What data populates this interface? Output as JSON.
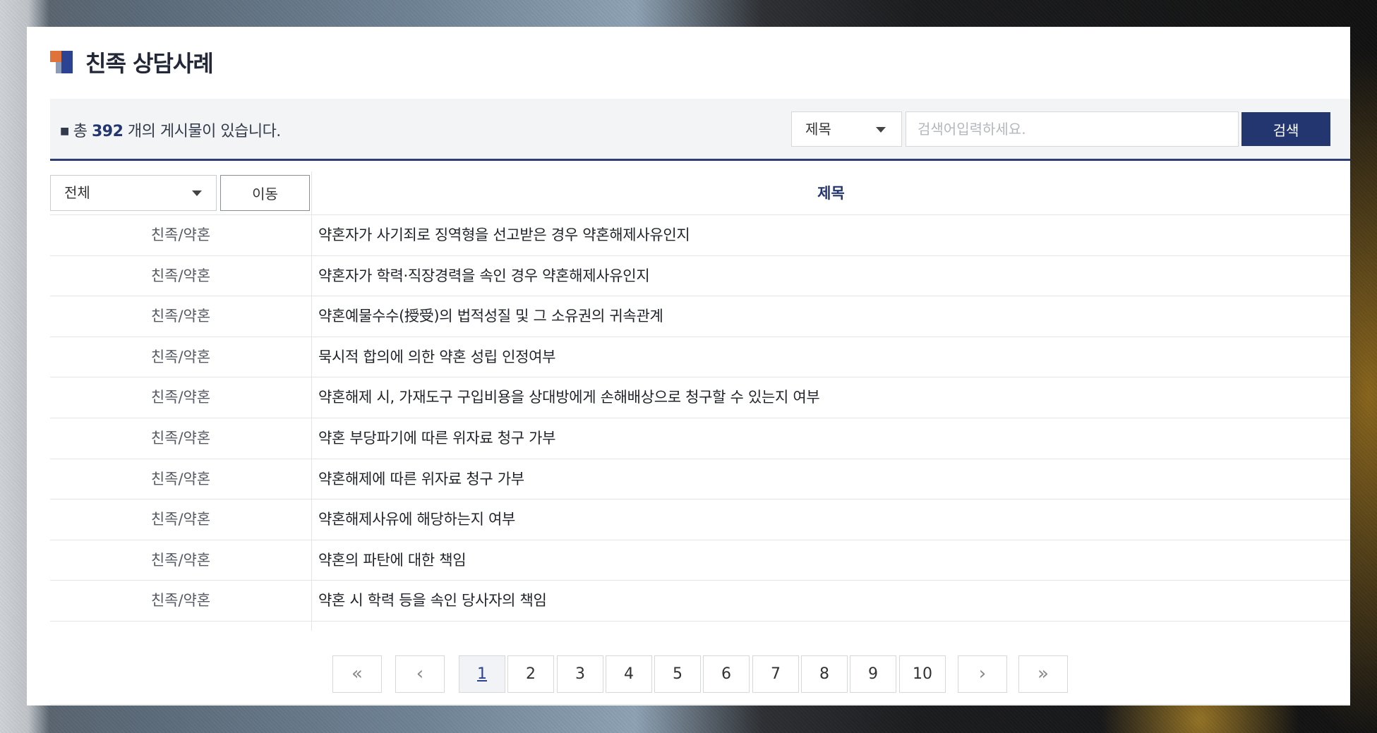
{
  "page": {
    "title": "친족 상담사례"
  },
  "info": {
    "count_prefix": "총",
    "count": "392",
    "count_suffix": "개의 게시물이 있습니다."
  },
  "search": {
    "field_selected": "제목",
    "placeholder": "검색어입력하세요.",
    "button_label": "검색"
  },
  "table": {
    "category_selected": "전체",
    "move_label": "이동",
    "column_title": "제목",
    "rows": [
      {
        "category": "친족/약혼",
        "subject": "약혼자가 사기죄로 징역형을 선고받은 경우 약혼해제사유인지"
      },
      {
        "category": "친족/약혼",
        "subject": "약혼자가 학력·직장경력을 속인 경우 약혼해제사유인지"
      },
      {
        "category": "친족/약혼",
        "subject": "약혼예물수수(授受)의 법적성질 및 그 소유권의 귀속관계"
      },
      {
        "category": "친족/약혼",
        "subject": "묵시적 합의에 의한 약혼 성립 인정여부"
      },
      {
        "category": "친족/약혼",
        "subject": "약혼해제 시, 가재도구 구입비용을 상대방에게 손해배상으로 청구할 수 있는지 여부"
      },
      {
        "category": "친족/약혼",
        "subject": "약혼 부당파기에 따른 위자료 청구 가부"
      },
      {
        "category": "친족/약혼",
        "subject": "약혼해제에 따른 위자료 청구 가부"
      },
      {
        "category": "친족/약혼",
        "subject": "약혼해제사유에 해당하는지 여부"
      },
      {
        "category": "친족/약혼",
        "subject": "약혼의 파탄에 대한 책임"
      },
      {
        "category": "친족/약혼",
        "subject": "약혼 시 학력 등을 속인 당사자의 책임"
      }
    ]
  },
  "pagination": {
    "first": "«",
    "prev": "‹",
    "next": "›",
    "last": "»",
    "current": "1",
    "pages": [
      "1",
      "2",
      "3",
      "4",
      "5",
      "6",
      "7",
      "8",
      "9",
      "10"
    ]
  },
  "colors": {
    "accent_navy": "#23366f",
    "mark_orange": "#e0733a",
    "mark_blue": "#2c4393"
  }
}
